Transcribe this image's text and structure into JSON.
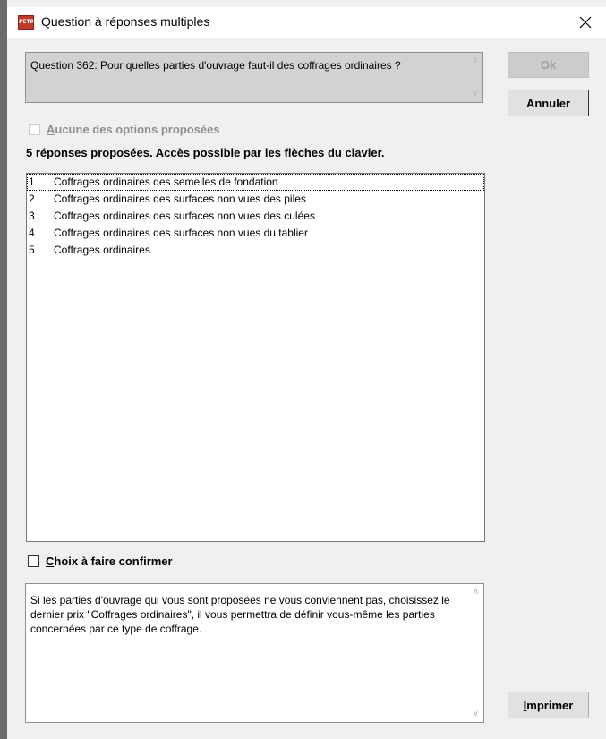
{
  "window": {
    "title": "Question à réponses multiples",
    "app_icon_text": "PETRA",
    "close_glyph": "✕"
  },
  "question": {
    "text": "Question 362: Pour quelles parties d'ouvrage faut-il des coffrages ordinaires ?"
  },
  "buttons": {
    "ok": "Ok",
    "cancel": "Annuler",
    "print_mnemonic": "I",
    "print_rest": "mprimer"
  },
  "none_option": {
    "mnemonic": "A",
    "rest": "ucune des options proposées",
    "checked": false,
    "enabled": false
  },
  "instructions": "5 réponses proposées. Accès possible par les flèches du clavier.",
  "answers": [
    {
      "num": "1",
      "text": "Coffrages ordinaires des semelles de fondation"
    },
    {
      "num": "2",
      "text": "Coffrages ordinaires des surfaces non vues des piles"
    },
    {
      "num": "3",
      "text": "Coffrages ordinaires des surfaces non vues des culées"
    },
    {
      "num": "4",
      "text": "Coffrages ordinaires des surfaces non vues du tablier"
    },
    {
      "num": "5",
      "text": "Coffrages ordinaires"
    }
  ],
  "confirm_option": {
    "mnemonic": "C",
    "rest": "hoix à faire confirmer",
    "checked": false
  },
  "help": {
    "text": "Si les parties d'ouvrage qui vous sont proposées ne vous conviennent pas, choisissez le dernier prix \"Coffrages ordinaires\", il vous permettra de définir vous-même les parties concernées par ce type de coffrage."
  },
  "icons": {
    "scroll_up": "up-arrow-icon",
    "scroll_down": "down-arrow-icon",
    "close": "close-icon"
  },
  "colors": {
    "question_bg": "#d2d2d2",
    "dialog_bg": "#f0f0f0",
    "disabled_text": "#8f8f8f",
    "app_icon": "#c0392b"
  }
}
